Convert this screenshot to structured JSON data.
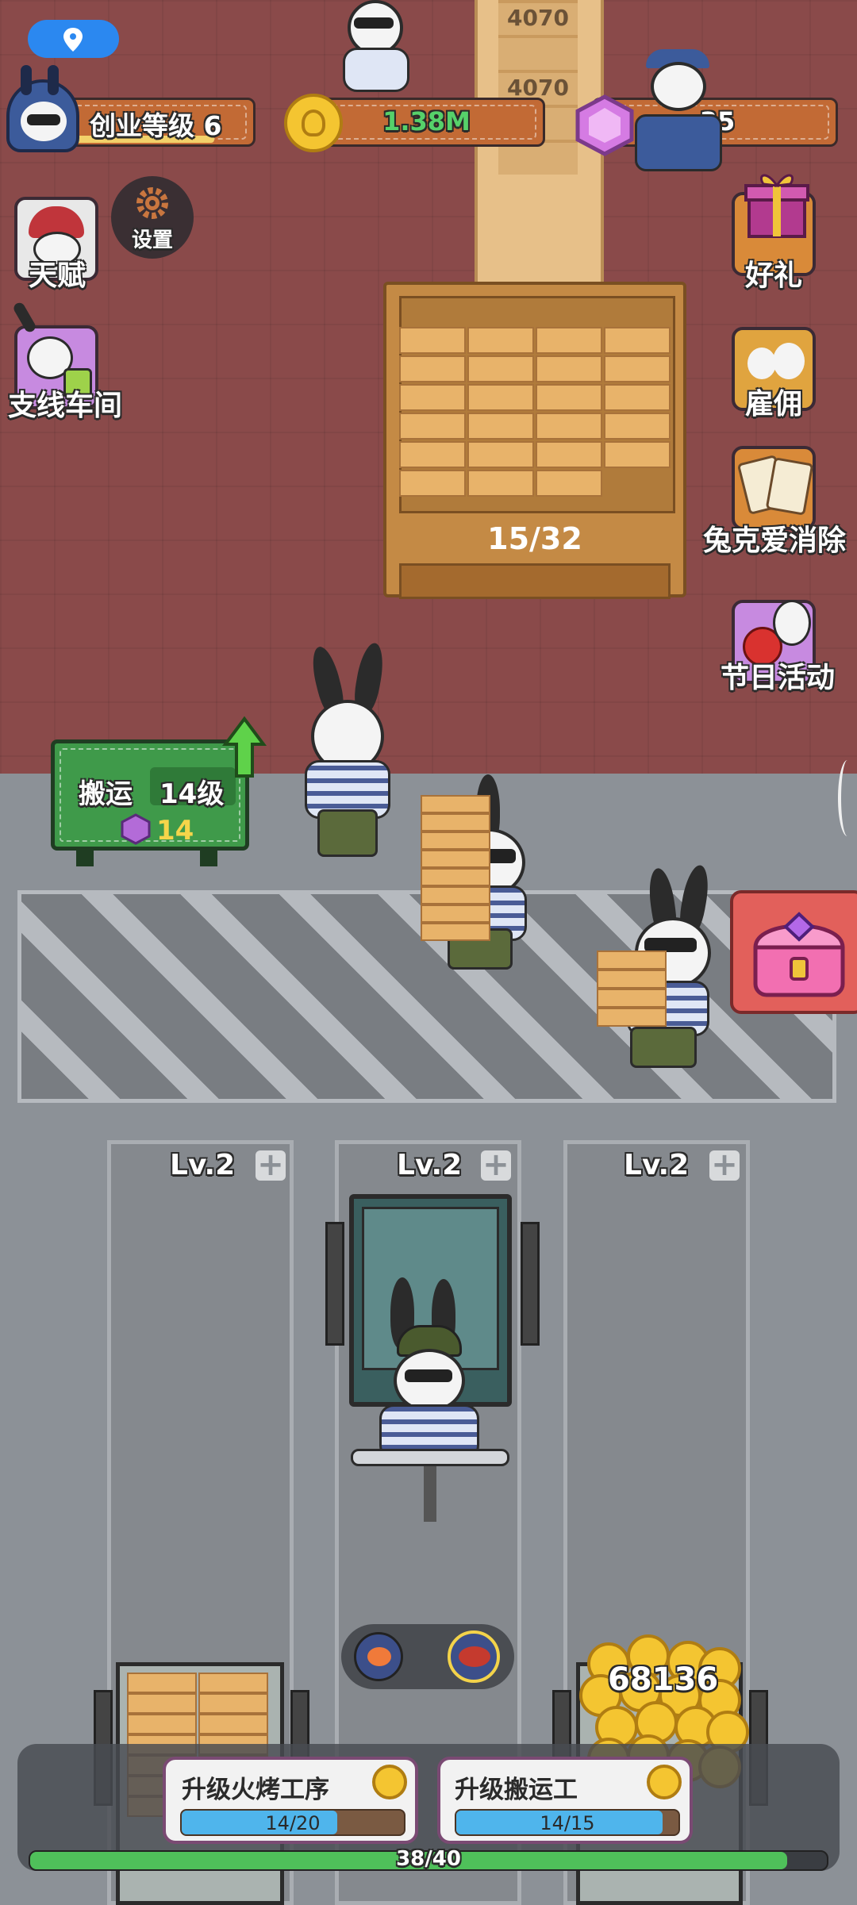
{
  "hud": {
    "level_label": "创业等级 6",
    "coins": "1.38M",
    "gems": "35",
    "level_progress": 0.85
  },
  "menu": {
    "settings": "设置",
    "talent": "天赋",
    "branch_workshop": "支线车间",
    "gift": "好礼",
    "hire": "雇佣",
    "bunny_elimination": "兔克爱消除",
    "festival": "节日活动"
  },
  "conveyor": {
    "top_counter_1": "4070",
    "top_counter_2": "4070",
    "stock": "15/32",
    "stock_fraction": 0.47
  },
  "transport_panel": {
    "label": "搬运",
    "level": "14级",
    "cost": "14"
  },
  "lanes": [
    {
      "label": "Lv.2"
    },
    {
      "label": "Lv.2"
    },
    {
      "label": "Lv.2"
    }
  ],
  "coin_pile": "68136",
  "upgrades": [
    {
      "label": "升级火烤工序",
      "progress": "14/20",
      "fraction": 0.7
    },
    {
      "label": "升级搬运工",
      "progress": "14/15",
      "fraction": 0.93
    }
  ],
  "bottom_progress": {
    "text": "38/40",
    "fraction": 0.95
  },
  "colors": {
    "factory_floor": "#8a4a4a",
    "yard_floor": "#8c9197",
    "accent_green": "#3f9a4a",
    "gem_purple": "#9a4fd0",
    "progress_blue": "#4fb5ec"
  }
}
